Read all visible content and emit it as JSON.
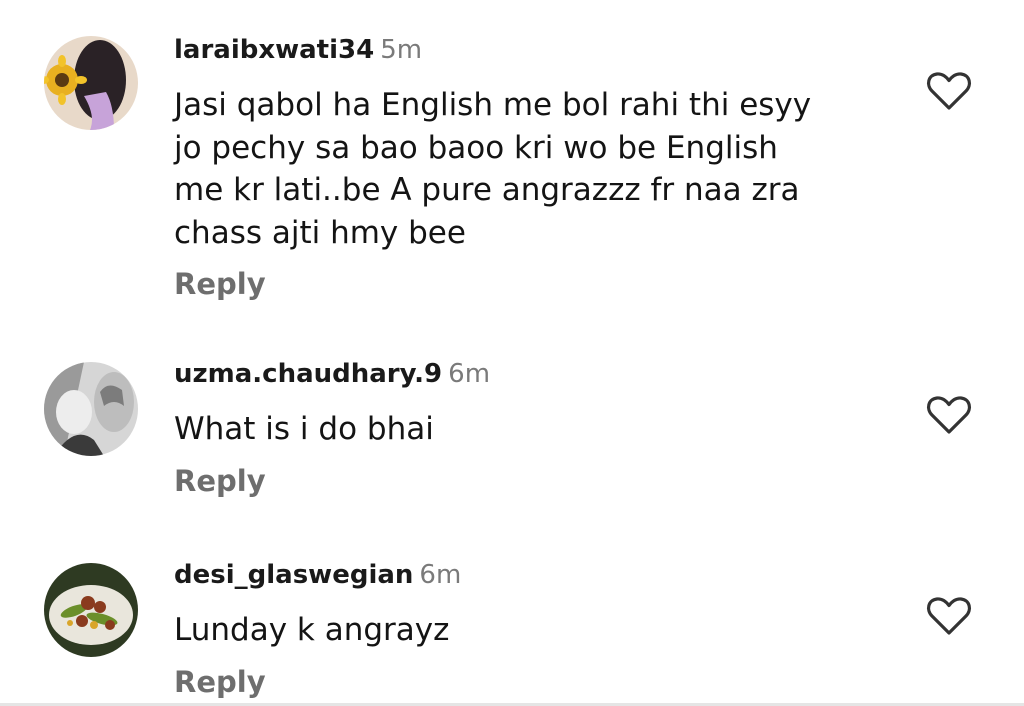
{
  "comments": [
    {
      "username": "laraibxwati34",
      "time": "5m",
      "text": "Jasi qabol ha English me bol rahi thi esyy\njo pechy sa bao baoo kri wo be English\nme kr lati..be A pure angrazzz fr naa  zra\nchass ajti hmy bee",
      "reply_label": "Reply",
      "like_icon": "heart-outline-icon"
    },
    {
      "username": "uzma.chaudhary.9",
      "time": "6m",
      "text": "What is i do bhai",
      "reply_label": "Reply",
      "like_icon": "heart-outline-icon"
    },
    {
      "username": "desi_glaswegian",
      "time": "6m",
      "text": "Lunday k angrayz",
      "reply_label": "Reply",
      "like_icon": "heart-outline-icon"
    }
  ],
  "colors": {
    "username": "#1a1a1a",
    "time": "#7a7a7a",
    "text": "#141414",
    "reply": "#6e6e6e",
    "heart_stroke": "#333333"
  }
}
